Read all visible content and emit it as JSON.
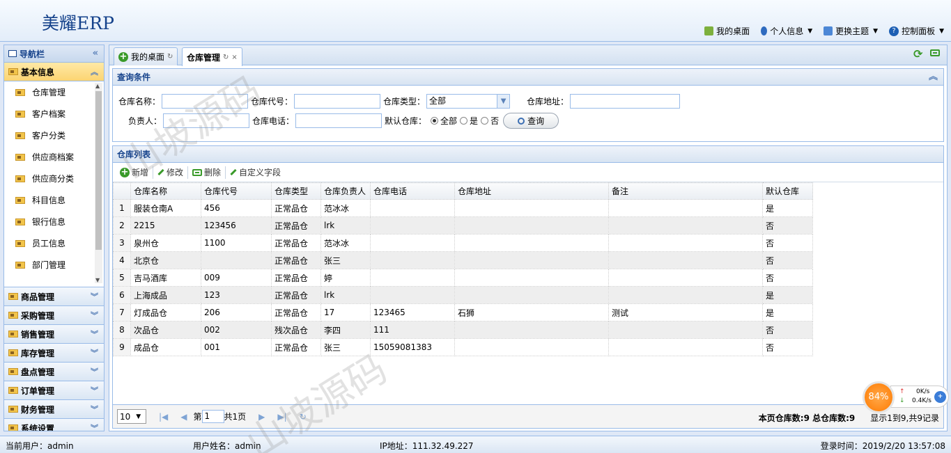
{
  "header": {
    "logo": "美耀ERP",
    "nav": [
      {
        "label": "我的桌面",
        "icon": "desktop-icon",
        "caret": false
      },
      {
        "label": "个人信息",
        "icon": "user-icon",
        "caret": true
      },
      {
        "label": "更换主题",
        "icon": "theme-icon",
        "caret": true
      },
      {
        "label": "控制面板",
        "icon": "help-icon",
        "caret": true
      }
    ]
  },
  "sidebar": {
    "title": "导航栏",
    "active_group": "基本信息",
    "items": [
      "仓库管理",
      "客户档案",
      "客户分类",
      "供应商档案",
      "供应商分类",
      "科目信息",
      "银行信息",
      "员工信息",
      "部门管理"
    ],
    "groups": [
      "商品管理",
      "采购管理",
      "销售管理",
      "库存管理",
      "盘点管理",
      "订单管理",
      "财务管理",
      "系统设置"
    ]
  },
  "tabs": [
    {
      "label": "我的桌面",
      "refresh": "↻"
    },
    {
      "label": "仓库管理",
      "refresh": "↻",
      "close": "×"
    }
  ],
  "query": {
    "title": "查询条件",
    "labels": {
      "name": "仓库名称：",
      "code": "仓库代号：",
      "type": "仓库类型：",
      "address": "仓库地址：",
      "manager": "负责人：",
      "phone": "仓库电话：",
      "default": "默认仓库："
    },
    "type_value": "全部",
    "radio": [
      "全部",
      "是",
      "否"
    ],
    "button": "查询"
  },
  "list": {
    "title": "仓库列表",
    "toolbar": [
      "新增",
      "修改",
      "删除",
      "自定义字段"
    ],
    "columns": [
      "仓库名称",
      "仓库代号",
      "仓库类型",
      "仓库负责人",
      "仓库电话",
      "仓库地址",
      "备注",
      "默认仓库"
    ],
    "rows": [
      {
        "n": "1",
        "name": "服装仓南A",
        "code": "456",
        "type": "正常品仓",
        "manager": "范冰冰",
        "phone": "",
        "address": "",
        "remark": "",
        "default": "是"
      },
      {
        "n": "2",
        "name": "2215",
        "code": "123456",
        "type": "正常品仓",
        "manager": "lrk",
        "phone": "",
        "address": "",
        "remark": "",
        "default": "否"
      },
      {
        "n": "3",
        "name": "泉州仓",
        "code": "1100",
        "type": "正常品仓",
        "manager": "范冰冰",
        "phone": "",
        "address": "",
        "remark": "",
        "default": "否"
      },
      {
        "n": "4",
        "name": "北京仓",
        "code": "",
        "type": "正常品仓",
        "manager": "张三",
        "phone": "",
        "address": "",
        "remark": "",
        "default": "否"
      },
      {
        "n": "5",
        "name": "吉马酒库",
        "code": "009",
        "type": "正常品仓",
        "manager": "婷",
        "phone": "",
        "address": "",
        "remark": "",
        "default": "否"
      },
      {
        "n": "6",
        "name": "上海成品",
        "code": "123",
        "type": "正常品仓",
        "manager": "lrk",
        "phone": "",
        "address": "",
        "remark": "",
        "default": "是"
      },
      {
        "n": "7",
        "name": "灯成品仓",
        "code": "206",
        "type": "正常品仓",
        "manager": "17",
        "phone": "123465",
        "address": "石狮",
        "remark": "测试",
        "default": "是"
      },
      {
        "n": "8",
        "name": "次品仓",
        "code": "002",
        "type": "残次品仓",
        "manager": "李四",
        "phone": "111",
        "address": "",
        "remark": "",
        "default": "否"
      },
      {
        "n": "9",
        "name": "成品仓",
        "code": "001",
        "type": "正常品仓",
        "manager": "张三",
        "phone": "15059081383",
        "address": "",
        "remark": "",
        "default": "否"
      }
    ]
  },
  "pager": {
    "page_size": "10",
    "page_prefix": "第",
    "page_value": "1",
    "total_pages": "共1页",
    "page_count": "本页仓库数:9",
    "total_count": "总仓库数:9",
    "display": "显示1到9,共9记录"
  },
  "status": {
    "user": "当前用户：admin",
    "name": "用户姓名：admin",
    "ip": "IP地址：111.32.49.227",
    "login": "登录时间：2019/2/20 13:57:08"
  },
  "speed": {
    "percent": "84%",
    "up": "0K/s",
    "down": "0.4K/s"
  },
  "watermark": "山坡源码"
}
